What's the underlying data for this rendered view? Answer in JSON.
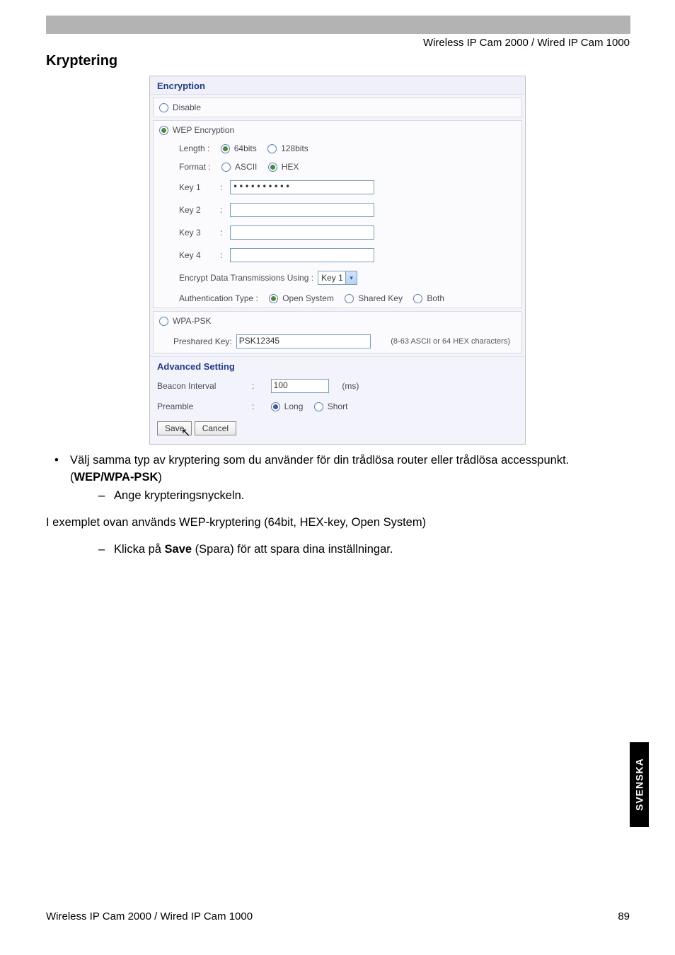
{
  "header": {
    "product_line": "Wireless IP Cam 2000 / Wired IP Cam 1000"
  },
  "section_title": "Kryptering",
  "panel": {
    "encryption_header": "Encryption",
    "disable_label": "Disable",
    "wep_label": "WEP Encryption",
    "length_label": "Length :",
    "length_64": "64bits",
    "length_128": "128bits",
    "format_label": "Format :",
    "format_ascii": "ASCII",
    "format_hex": "HEX",
    "key1_label": "Key 1",
    "key2_label": "Key 2",
    "key3_label": "Key 3",
    "key4_label": "Key 4",
    "key1_value": "••••••••••",
    "encrypt_using_label": "Encrypt Data Transmissions Using :",
    "encrypt_using_value": "Key 1",
    "auth_label": "Authentication Type :",
    "auth_open": "Open System",
    "auth_shared": "Shared Key",
    "auth_both": "Both",
    "wpa_label": "WPA-PSK",
    "preshared_label": "Preshared Key:",
    "preshared_value": "PSK12345",
    "preshared_hint": "(8-63 ASCII or 64 HEX characters)",
    "advanced_header": "Advanced Setting",
    "beacon_label": "Beacon Interval",
    "beacon_value": "100",
    "beacon_unit": "(ms)",
    "preamble_label": "Preamble",
    "preamble_long": "Long",
    "preamble_short": "Short",
    "save_btn": "Save",
    "cancel_btn": "Cancel"
  },
  "instructions": {
    "bullet1_pre": "Välj samma typ av kryptering som du använder för din trådlösa router eller trådlösa accesspunkt. (",
    "bullet1_bold": "WEP/WPA-PSK",
    "bullet1_post": ")",
    "sub1": "Ange krypteringsnyckeln.",
    "example": "I exemplet ovan används WEP-kryptering (64bit, HEX-key, Open System)",
    "sub2_pre": "Klicka på ",
    "sub2_bold": "Save",
    "sub2_post": " (Spara) för att spara dina inställningar."
  },
  "side_tab": "SVENSKA",
  "footer": {
    "left": "Wireless IP Cam 2000 / Wired IP Cam 1000",
    "page": "89"
  }
}
